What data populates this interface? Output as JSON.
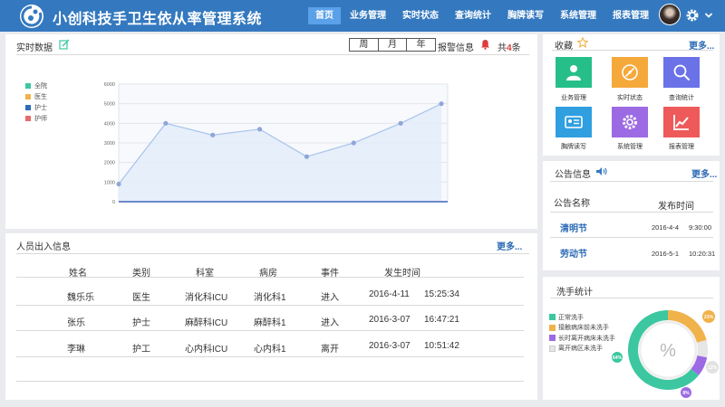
{
  "app": {
    "title": "小创科技手卫生依从率管理系统"
  },
  "nav": {
    "items": [
      {
        "label": "首页",
        "active": true
      },
      {
        "label": "业务管理",
        "active": false
      },
      {
        "label": "实时状态",
        "active": false
      },
      {
        "label": "查询统计",
        "active": false
      },
      {
        "label": "胸牌读写",
        "active": false
      },
      {
        "label": "系统管理",
        "active": false
      },
      {
        "label": "报表管理",
        "active": false
      }
    ]
  },
  "realtime": {
    "title": "实时数据",
    "period_tabs": [
      "周",
      "月",
      "年"
    ],
    "alarm_label": "报警信息",
    "alarm_prefix": "共",
    "alarm_count": "4",
    "alarm_suffix": "条"
  },
  "chart_data": {
    "type": "area",
    "legend": [
      {
        "name": "全院",
        "color": "#3cc7a0"
      },
      {
        "name": "医生",
        "color": "#f0b24a"
      },
      {
        "name": "护士",
        "color": "#2d6db8"
      },
      {
        "name": "护师",
        "color": "#e96a6a"
      }
    ],
    "yticks": [
      "0",
      "1000",
      "2000",
      "3000",
      "4000",
      "5000",
      "6000"
    ],
    "ylim": [
      0,
      6000
    ],
    "values": [
      900,
      4000,
      3400,
      3700,
      2300,
      3000,
      4000,
      5000
    ],
    "colors": {
      "line": "#a9c4ec",
      "fill": "#e3edf9",
      "point": "#8fa6d8"
    }
  },
  "people": {
    "title": "人员出入信息",
    "more": "更多...",
    "columns": [
      "姓名",
      "类别",
      "科室",
      "病房",
      "事件",
      "发生时间"
    ],
    "rows": [
      {
        "name": "魏乐乐",
        "category": "医生",
        "dept": "消化科ICU",
        "ward": "消化科1",
        "event": "进入",
        "date": "2016-4-11",
        "time": "15:25:34"
      },
      {
        "name": "张乐",
        "category": "护士",
        "dept": "麻醉科ICU",
        "ward": "麻醉科1",
        "event": "进入",
        "date": "2016-3-07",
        "time": "16:47:21"
      },
      {
        "name": "李琳",
        "category": "护工",
        "dept": "心内科ICU",
        "ward": "心内科1",
        "event": "离开",
        "date": "2016-3-07",
        "time": "10:51:42"
      }
    ]
  },
  "favorites": {
    "title": "收藏",
    "more": "更多...",
    "items": [
      {
        "label": "业务管理",
        "icon": "user-icon",
        "color": "#26bf8a"
      },
      {
        "label": "实时状态",
        "icon": "compass-icon",
        "color": "#f5a93a"
      },
      {
        "label": "查询统计",
        "icon": "search-icon",
        "color": "#6b72e8"
      },
      {
        "label": "胸牌读写",
        "icon": "id-card-icon",
        "color": "#2f9fe0"
      },
      {
        "label": "系统管理",
        "icon": "gear-icon",
        "color": "#9c6be3"
      },
      {
        "label": "报表管理",
        "icon": "chart-icon",
        "color": "#ee5a5a"
      }
    ]
  },
  "notices": {
    "title": "公告信息",
    "more": "更多...",
    "col_name": "公告名称",
    "col_time": "发布时间",
    "items": [
      {
        "name": "清明节",
        "date": "2016-4-4",
        "time": "9:30:00"
      },
      {
        "name": "劳动节",
        "date": "2016-5-1",
        "time": "10:20:31"
      }
    ]
  },
  "handwash": {
    "title": "洗手统计",
    "center": "%",
    "legend": [
      {
        "label": "正常洗手",
        "color": "#3cc7a0"
      },
      {
        "label": "接触病床前未洗手",
        "color": "#f0b24a"
      },
      {
        "label": "长时离开病床未洗手",
        "color": "#9c6be3"
      },
      {
        "label": "离开病区未洗手",
        "color": "#dcdcdc"
      }
    ],
    "slices": [
      {
        "label": "正常洗手",
        "value": 64,
        "text": "64%",
        "color": "#3cc7a0"
      },
      {
        "label": "接触病床前未洗手",
        "value": 21,
        "text": "21%",
        "color": "#f0b24a"
      },
      {
        "label": "离开病区未洗手",
        "value": 7,
        "text": "12%",
        "color": "#e6e6e6"
      },
      {
        "label": "长时离开病床未洗手",
        "value": 8,
        "text": "8%",
        "color": "#9c6be3"
      }
    ],
    "slice_labels": [
      "21%",
      "12%",
      "8%",
      "64%"
    ]
  }
}
